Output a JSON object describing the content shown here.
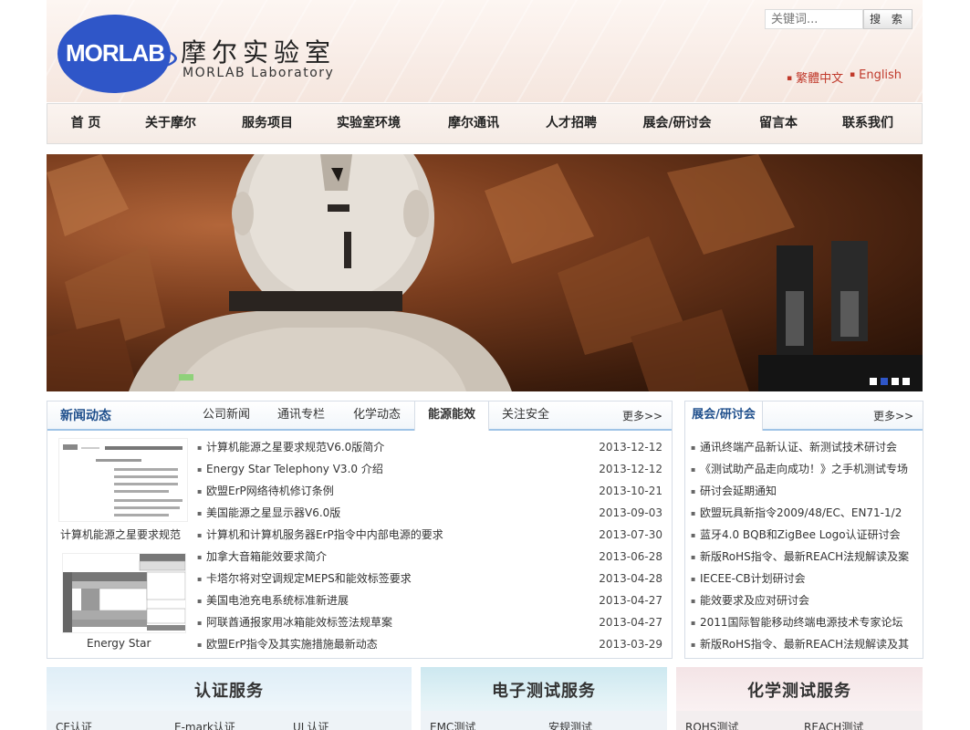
{
  "header": {
    "logo_text": "MORLAB",
    "name_cn": "摩尔实验室",
    "name_en": "MORLAB Laboratory",
    "search_placeholder": "关键词...",
    "search_button": "搜 索",
    "lang_traditional": "繁體中文",
    "lang_english": "English"
  },
  "nav": [
    "首 页",
    "关于摩尔",
    "服务项目",
    "实验室环境",
    "摩尔通讯",
    "人才招聘",
    "展会/研讨会",
    "留言本",
    "联系我们"
  ],
  "banner": {
    "slides": 4,
    "active_slide": 2
  },
  "news": {
    "title": "新闻动态",
    "tabs": [
      "公司新闻",
      "通讯专栏",
      "化学动态",
      "能源能效",
      "关注安全"
    ],
    "active_tab": "能源能效",
    "more": "更多>>",
    "thumb1_caption": "计算机能源之星要求规范",
    "thumb2_caption": "Energy Star",
    "items": [
      {
        "title": "计算机能源之星要求规范V6.0版简介",
        "date": "2013-12-12"
      },
      {
        "title": "Energy Star Telephony V3.0 介绍",
        "date": "2013-12-12"
      },
      {
        "title": "欧盟ErP网络待机修订条例",
        "date": "2013-10-21"
      },
      {
        "title": "美国能源之星显示器V6.0版",
        "date": "2013-09-03"
      },
      {
        "title": "计算机和计算机服务器ErP指令中内部电源的要求",
        "date": "2013-07-30"
      },
      {
        "title": "加拿大音箱能效要求简介",
        "date": "2013-06-28"
      },
      {
        "title": "卡塔尔将对空调规定MEPS和能效标签要求",
        "date": "2013-04-28"
      },
      {
        "title": "美国电池充电系统标准新进展",
        "date": "2013-04-27"
      },
      {
        "title": "阿联酋通报家用冰箱能效标签法规草案",
        "date": "2013-04-27"
      },
      {
        "title": "欧盟ErP指令及其实施措施最新动态",
        "date": "2013-03-29"
      }
    ]
  },
  "expo": {
    "title": "展会/研讨会",
    "more": "更多>>",
    "items": [
      "通讯终端产品新认证、新测试技术研讨会",
      "《测试助产品走向成功！》之手机测试专场",
      "研讨会延期通知",
      "欧盟玩具新指令2009/48/EC、EN71-1/2",
      "蓝牙4.0 BQB和ZigBee Logo认证研讨会",
      "新版RoHS指令、最新REACH法规解读及案",
      "IECEE-CB计划研讨会",
      "能效要求及应对研讨会",
      "2011国际智能移动终端电源技术专家论坛",
      "新版RoHS指令、最新REACH法规解读及其"
    ]
  },
  "cards": [
    {
      "title": "认证服务",
      "links": [
        "CE认证",
        "E-mark认证",
        "UL认证"
      ]
    },
    {
      "title": "电子测试服务",
      "links": [
        "EMC测试",
        "安规测试"
      ]
    },
    {
      "title": "化学测试服务",
      "links": [
        "ROHS测试",
        "REACH测试"
      ]
    }
  ],
  "colors": {
    "brand_blue": "#2f56c8",
    "accent_red": "#c0392b",
    "title_blue": "#1f4f8c"
  }
}
